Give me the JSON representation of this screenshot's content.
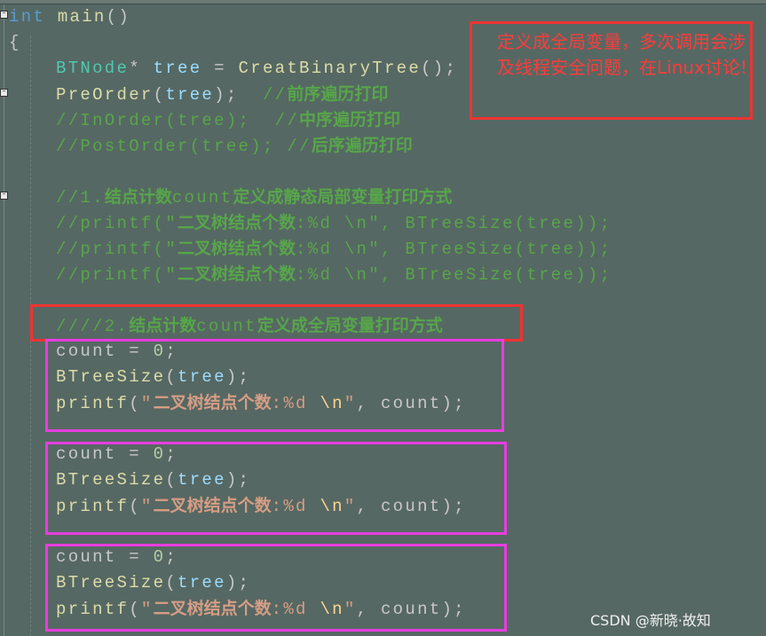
{
  "annotation": "定义成全局变量，多次调用会涉及线程安全问题，在Linux讨论!",
  "watermark": "CSDN @新晓·故知",
  "colors": {
    "background": "#566863",
    "annotation_red": "#ee3333",
    "highlight_magenta": "#e83de0"
  },
  "code_lines": [
    {
      "indent": 0,
      "tokens": [
        [
          "int",
          "kw"
        ],
        [
          " ",
          "pl"
        ],
        [
          "main",
          "fn"
        ],
        [
          "()",
          "pl"
        ]
      ]
    },
    {
      "indent": 0,
      "tokens": [
        [
          "{",
          "pl"
        ]
      ]
    },
    {
      "indent": 1,
      "tokens": [
        [
          "BTNode",
          "ty"
        ],
        [
          "* ",
          "pl"
        ],
        [
          "tree",
          "var"
        ],
        [
          " = ",
          "pl"
        ],
        [
          "CreatBinaryTree",
          "fn"
        ],
        [
          "();",
          "pl"
        ]
      ]
    },
    {
      "indent": 1,
      "tokens": [
        [
          "PreOrder",
          "fn"
        ],
        [
          "(",
          "pl"
        ],
        [
          "tree",
          "var"
        ],
        [
          ");  ",
          "pl"
        ],
        [
          "//",
          "cm"
        ],
        [
          "前序遍历打印",
          "cmz"
        ]
      ]
    },
    {
      "indent": 1,
      "tokens": [
        [
          "//InOrder(tree);  //",
          "cm"
        ],
        [
          "中序遍历打印",
          "cmz"
        ]
      ]
    },
    {
      "indent": 1,
      "tokens": [
        [
          "//PostOrder(tree); //",
          "cm"
        ],
        [
          "后序遍历打印",
          "cmz"
        ]
      ]
    },
    {
      "indent": 1,
      "tokens": []
    },
    {
      "indent": 1,
      "tokens": [
        [
          "//1.",
          "cm"
        ],
        [
          "结点计数",
          "cmz"
        ],
        [
          "count",
          "cm"
        ],
        [
          "定义成静态局部变量打印方式",
          "cmz"
        ]
      ]
    },
    {
      "indent": 1,
      "tokens": [
        [
          "//printf(\"",
          "cm"
        ],
        [
          "二叉树结点个数",
          "cmz"
        ],
        [
          ":%d \\n\", BTreeSize(tree));",
          "cm"
        ]
      ]
    },
    {
      "indent": 1,
      "tokens": [
        [
          "//printf(\"",
          "cm"
        ],
        [
          "二叉树结点个数",
          "cmz"
        ],
        [
          ":%d \\n\", BTreeSize(tree));",
          "cm"
        ]
      ]
    },
    {
      "indent": 1,
      "tokens": [
        [
          "//printf(\"",
          "cm"
        ],
        [
          "二叉树结点个数",
          "cmz"
        ],
        [
          ":%d \\n\", BTreeSize(tree));",
          "cm"
        ]
      ]
    },
    {
      "indent": 1,
      "tokens": []
    },
    {
      "indent": 1,
      "tokens": [
        [
          "////2.",
          "cm"
        ],
        [
          "结点计数",
          "cmz"
        ],
        [
          "count",
          "cm"
        ],
        [
          "定义成全局变量打印方式",
          "cmz"
        ]
      ]
    },
    {
      "indent": 1,
      "tokens": [
        [
          "count = ",
          "pl"
        ],
        [
          "0",
          "num"
        ],
        [
          ";",
          "pl"
        ]
      ]
    },
    {
      "indent": 1,
      "tokens": [
        [
          "BTreeSize",
          "fn"
        ],
        [
          "(",
          "pl"
        ],
        [
          "tree",
          "var"
        ],
        [
          ");",
          "pl"
        ]
      ]
    },
    {
      "indent": 1,
      "tokens": [
        [
          "printf",
          "fn"
        ],
        [
          "(",
          "pl"
        ],
        [
          "\"",
          "str"
        ],
        [
          "二叉树结点个数",
          "strz"
        ],
        [
          ":%d ",
          "str"
        ],
        [
          "\\n",
          "esc"
        ],
        [
          "\"",
          "str"
        ],
        [
          ", count);",
          "pl"
        ]
      ]
    },
    {
      "indent": 1,
      "tokens": []
    },
    {
      "indent": 1,
      "tokens": [
        [
          "count = ",
          "pl"
        ],
        [
          "0",
          "num"
        ],
        [
          ";",
          "pl"
        ]
      ]
    },
    {
      "indent": 1,
      "tokens": [
        [
          "BTreeSize",
          "fn"
        ],
        [
          "(",
          "pl"
        ],
        [
          "tree",
          "var"
        ],
        [
          ");",
          "pl"
        ]
      ]
    },
    {
      "indent": 1,
      "tokens": [
        [
          "printf",
          "fn"
        ],
        [
          "(",
          "pl"
        ],
        [
          "\"",
          "str"
        ],
        [
          "二叉树结点个数",
          "strz"
        ],
        [
          ":%d ",
          "str"
        ],
        [
          "\\n",
          "esc"
        ],
        [
          "\"",
          "str"
        ],
        [
          ", count);",
          "pl"
        ]
      ]
    },
    {
      "indent": 1,
      "tokens": []
    },
    {
      "indent": 1,
      "tokens": [
        [
          "count = ",
          "pl"
        ],
        [
          "0",
          "num"
        ],
        [
          ";",
          "pl"
        ]
      ]
    },
    {
      "indent": 1,
      "tokens": [
        [
          "BTreeSize",
          "fn"
        ],
        [
          "(",
          "pl"
        ],
        [
          "tree",
          "var"
        ],
        [
          ");",
          "pl"
        ]
      ]
    },
    {
      "indent": 1,
      "tokens": [
        [
          "printf",
          "fn"
        ],
        [
          "(",
          "pl"
        ],
        [
          "\"",
          "str"
        ],
        [
          "二叉树结点个数",
          "strz"
        ],
        [
          ":%d ",
          "str"
        ],
        [
          "\\n",
          "esc"
        ],
        [
          "\"",
          "str"
        ],
        [
          ", count);",
          "pl"
        ]
      ]
    }
  ]
}
